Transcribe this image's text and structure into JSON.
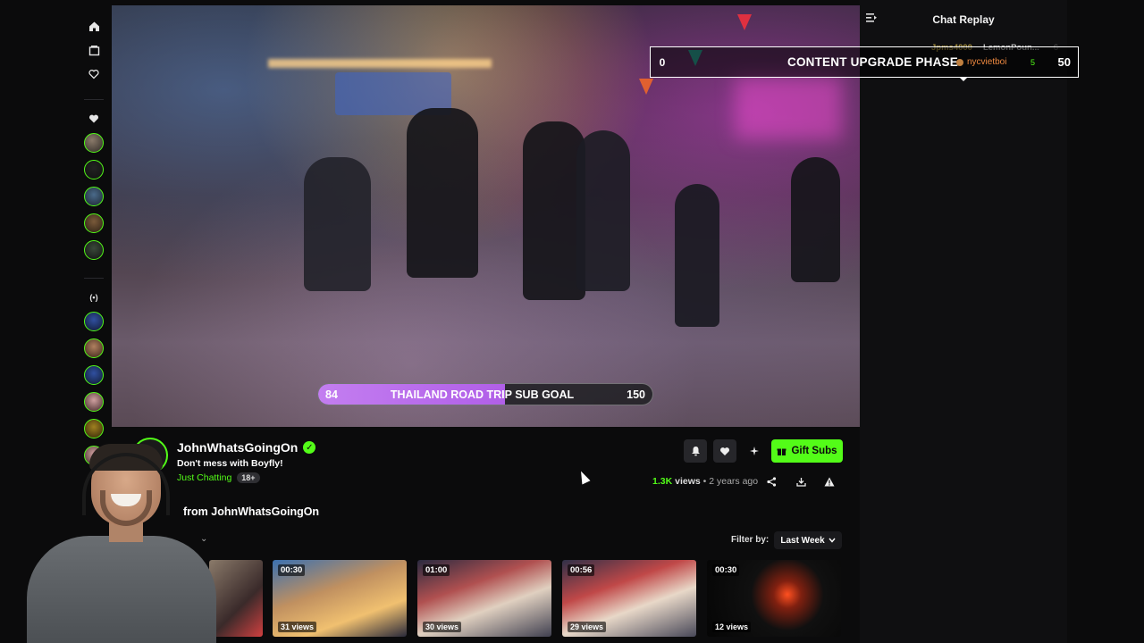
{
  "sidebar": {
    "nav_icons": [
      "home-icon",
      "following-icon",
      "heart-icon"
    ],
    "following_icon": "heart-icon",
    "live_icon": "live-broadcast-icon",
    "live_label": "(•)"
  },
  "video": {
    "sub_goal": {
      "current": "84",
      "title": "THAILAND ROAD TRIP SUB GOAL",
      "target": "150",
      "progress_fraction": 0.56
    },
    "upgrade_banner": {
      "left_value": "0",
      "title": "CONTENT UPGRADE PHASE",
      "user": "nycvietboi",
      "user_count": "5",
      "right_value": "50"
    }
  },
  "chat": {
    "title": "Chat Replay",
    "users": [
      {
        "name": "Jpms4000",
        "count": ""
      },
      {
        "name": "LemonPoun...",
        "count": "6"
      }
    ]
  },
  "channel": {
    "name": "JohnWhatsGoingOn",
    "verified_icon": "check",
    "title": "Don't mess with Boyfly!",
    "category": "Just Chatting",
    "badge": "18+",
    "gift_label": "Gift Subs",
    "views": "1.3K",
    "views_label": "views",
    "age": "• 2 years ago"
  },
  "clips": {
    "heading": "from JohnWhatsGoingOn",
    "filter_label": "Filter by:",
    "filter_value": "Last Week",
    "items": [
      {
        "duration": "",
        "views": ""
      },
      {
        "duration": "00:30",
        "views": "31 views"
      },
      {
        "duration": "01:00",
        "views": "30 views"
      },
      {
        "duration": "00:56",
        "views": "29 views"
      },
      {
        "duration": "00:30",
        "views": "12 views"
      }
    ]
  },
  "colors": {
    "accent": "#53fc18",
    "goal_fill": "#b15fe8",
    "background": "#0b0b0c"
  }
}
